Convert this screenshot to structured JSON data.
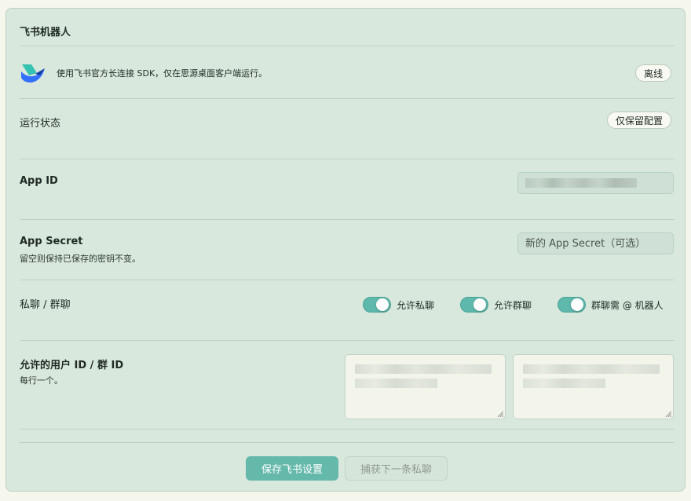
{
  "section_title": "飞书机器人",
  "intro": {
    "description": "使用飞书官方长连接 SDK，仅在思源桌面客户端运行。",
    "status_button": "离线"
  },
  "run_status": {
    "label": "运行状态",
    "button": "仅保留配置"
  },
  "app_id": {
    "label": "App ID"
  },
  "app_secret": {
    "label": "App Secret",
    "hint": "留空则保持已保存的密钥不变。",
    "placeholder": "新的 App Secret（可选）"
  },
  "chat_scope": {
    "label": "私聊 / 群聊",
    "toggles": [
      {
        "label": "允许私聊",
        "on": true
      },
      {
        "label": "允许群聊",
        "on": true
      },
      {
        "label": "群聊需 @ 机器人",
        "on": true
      }
    ]
  },
  "allowed_ids": {
    "label": "允许的用户 ID / 群 ID",
    "hint": "每行一个。"
  },
  "actions": {
    "save": "保存飞书设置",
    "capture": "捕获下一条私聊"
  },
  "colors": {
    "card_bg": "#d9e8dd",
    "accent": "#64b9aa",
    "toggle_on": "#5fb8ac"
  }
}
